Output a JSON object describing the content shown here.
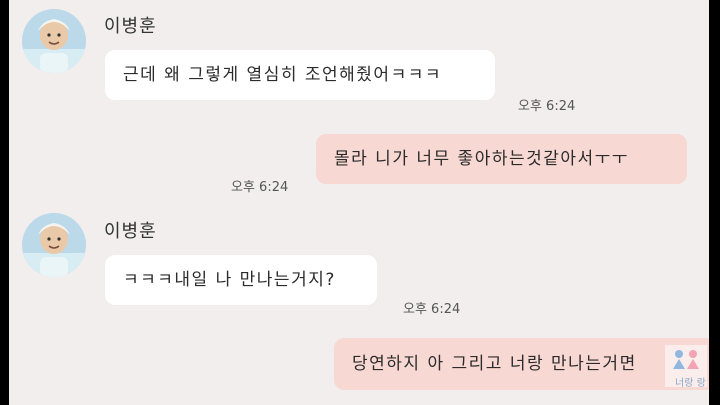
{
  "messages": [
    {
      "type": "incoming",
      "sender": "이병훈",
      "text": "근데 왜 그렇게 열심히 조언해줬어ㅋㅋㅋ",
      "time": "오후 6:24"
    },
    {
      "type": "outgoing",
      "text": "몰라 니가 너무 좋아하는것같아서ㅜㅜ",
      "time": "오후 6:24"
    },
    {
      "type": "incoming",
      "sender": "이병훈",
      "text": "ㅋㅋㅋ내일 나 만나는거지?",
      "time": "오후 6:24"
    },
    {
      "type": "outgoing",
      "text": "당연하지 아 그리고 너랑 만나는거면"
    }
  ],
  "watermark": {
    "label": "너랑 랑"
  },
  "colors": {
    "background": "#f2eeee",
    "incoming_bubble": "#ffffff",
    "outgoing_bubble": "#f7d8d2"
  }
}
